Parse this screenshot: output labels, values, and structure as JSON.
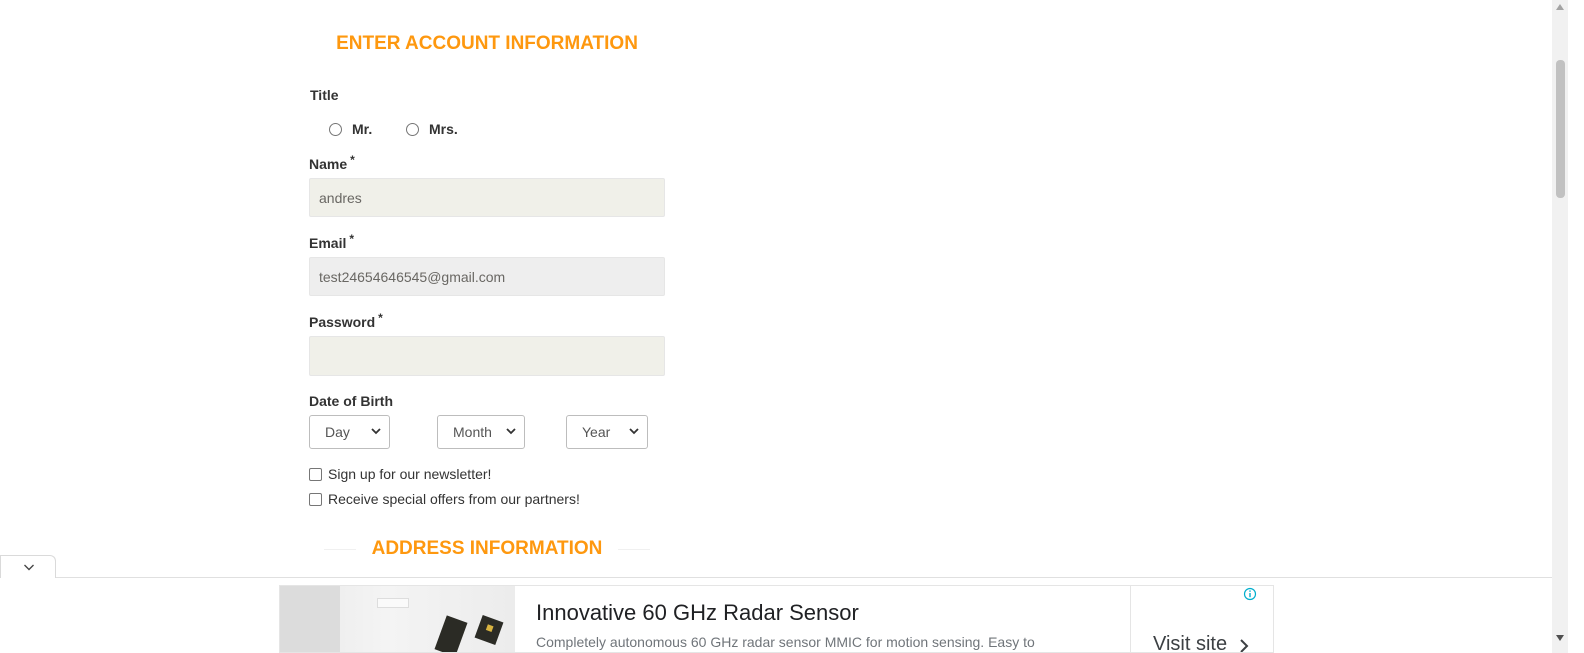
{
  "signup": {
    "title": "ENTER ACCOUNT INFORMATION",
    "title_label": "Title",
    "title_options": [
      "Mr.",
      "Mrs."
    ],
    "name_label": "Name",
    "name_value": "andres",
    "email_label": "Email",
    "email_value": "test24654646545@gmail.com",
    "password_label": "Password",
    "password_value": "",
    "required_marker": "*",
    "dob_label": "Date of Birth",
    "dob_day": "Day",
    "dob_month": "Month",
    "dob_year": "Year",
    "newsletter_label": "Sign up for our newsletter!",
    "offers_label": "Receive special offers from our partners!",
    "address_title": "ADDRESS INFORMATION"
  },
  "ad": {
    "title": "Innovative 60 GHz Radar Sensor",
    "description": "Completely autonomous 60 GHz radar sensor MMIC for motion sensing. Easy to",
    "cta": "Visit site",
    "info_icon": "info-icon"
  },
  "colors": {
    "accent": "#FE980F",
    "field_bg": "#F0F0E9",
    "disabled_bg": "#EEEEEE"
  }
}
